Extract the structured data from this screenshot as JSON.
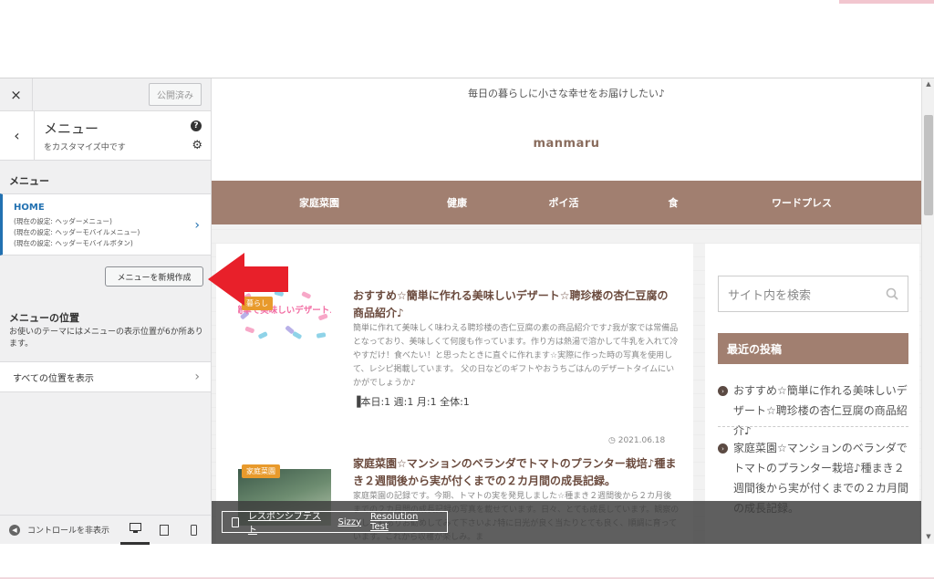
{
  "sidebar": {
    "close_label": "×",
    "publish_label": "公開済み",
    "back_label": "‹",
    "panel_title": "メニュー",
    "panel_subtitle": "をカスタマイズ中です",
    "help_label": "?",
    "section_title": "メニュー",
    "menu": {
      "name": "HOME",
      "locations": [
        "(現在の設定: ヘッダーメニュー)",
        "(現在の設定: ヘッダーモバイルメニュー)",
        "(現在の設定: ヘッダーモバイルボタン)"
      ]
    },
    "new_menu_label": "メニューを新規作成",
    "locations_title": "メニューの位置",
    "locations_desc": "お使いのテーマにはメニューの表示位置が6か所あります。",
    "view_all_label": "すべての位置を表示",
    "hide_controls_label": "コントロールを非表示"
  },
  "preview": {
    "tagline": "毎日の暮らしに小さな幸せをお届けしたい♪",
    "site_title": "manmaru",
    "nav": [
      "家庭菜園",
      "健康",
      "ポイ活",
      "食",
      "ワードプレス"
    ],
    "posts": [
      {
        "category": "暮らし",
        "thumb_text": "簡単で美味しいデザート♪",
        "title": "おすすめ☆簡単に作れる美味しいデザート☆聘珍楼の杏仁豆腐の商品紹介♪",
        "excerpt": "簡単に作れて美味しく味わえる聘珍楼の杏仁豆腐の素の商品紹介です♪我が家では常備品となっており、美味しくて何度も作っています。作り方は熱湯で溶かして牛乳を入れて冷やすだけ！食べたい！と思ったときに直ぐに作れます☆実際に作った時の写真を使用して、レシピ掲載しています。 父の日などのギフトやおうちごはんのデザートタイムにいかがでしょうか♪",
        "stats": "本日:1 週:1 月:1 全体:1"
      },
      {
        "category": "家庭菜園",
        "date": "2021.06.18",
        "title": "家庭菜園☆マンションのベランダでトマトのプランター栽培♪種まき２週間後から実が付くまでの２カ月間の成長記録。",
        "excerpt": "家庭菜園の記録です。今期、トマトの実を発見しました☆種まき２週間後から２カ月後までの２カ月間の成長記録の写真を載せています。日々、とても成長しています。観察の楽しさもありお勧めしてみて下さいよ♪特に日光が良く当たりとても良く、順調に育っています。これから収穫が楽しみ。ま"
      }
    ],
    "search_placeholder": "サイト内を検索",
    "recent_title": "最近の投稿",
    "recent_posts": [
      "おすすめ☆簡単に作れる美味しいデザート☆聘珍楼の杏仁豆腐の商品紹介♪",
      "家庭菜園☆マンションのベランダでトマトのプランター栽培♪種まき２週間後から実が付くまでの２カ月間の成長記録。"
    ]
  },
  "devbar": {
    "links": [
      "レスポンシブテスト",
      "Sizzy",
      "Resolution Test"
    ]
  },
  "colors": {
    "accent_brown": "#a17f70",
    "link_blue": "#2271b1",
    "badge_orange": "#e89a2c",
    "arrow_red": "#e8202a"
  }
}
